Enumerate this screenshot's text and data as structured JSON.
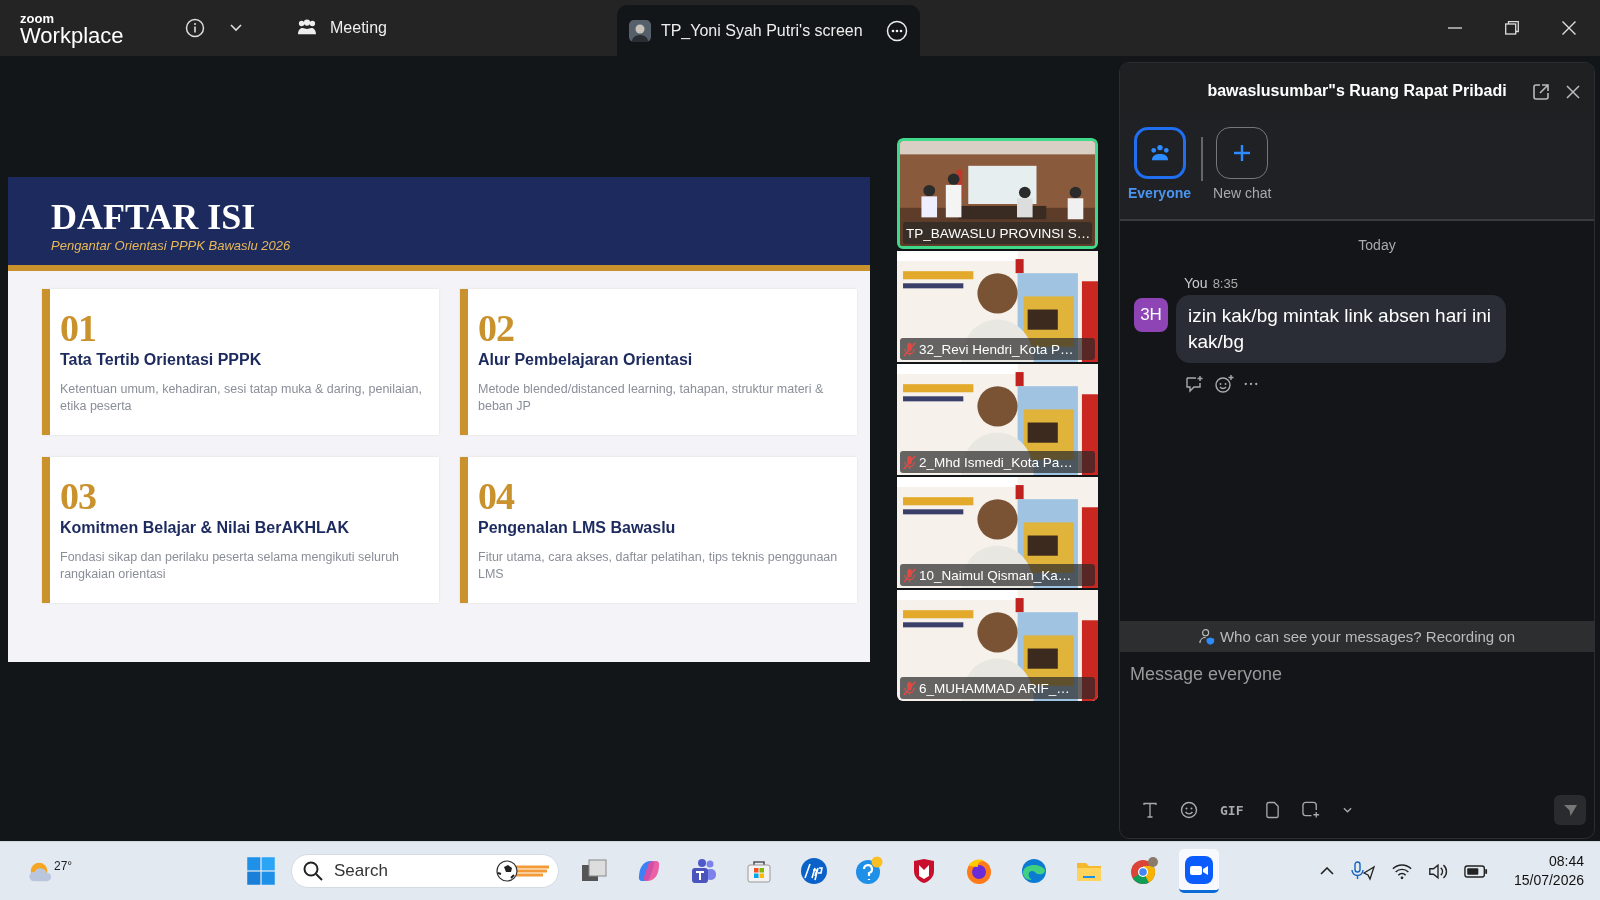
{
  "top_bar": {
    "logo_top": "zoom",
    "logo_bottom": "Workplace",
    "meeting_label": "Meeting",
    "share_tab": "TP_Yoni Syah Putri's screen"
  },
  "slide": {
    "title": "DAFTAR ISI",
    "subtitle": "Pengantar Orientasi PPPK Bawaslu 2026",
    "items": [
      {
        "number": "01",
        "title": "Tata Tertib Orientasi PPPK",
        "description": "Ketentuan umum, kehadiran, sesi tatap muka & daring, penilaian, etika peserta"
      },
      {
        "number": "02",
        "title": "Alur Pembelajaran Orientasi",
        "description": "Metode blended/distanced learning, tahapan, struktur materi & beban JP"
      },
      {
        "number": "03",
        "title": "Komitmen Belajar & Nilai BerAKHLAK",
        "description": "Fondasi sikap dan perilaku peserta selama mengikuti seluruh rangkaian orientasi"
      },
      {
        "number": "04",
        "title": "Pengenalan LMS Bawaslu",
        "description": "Fitur utama, cara akses, daftar pelatihan, tips teknis penggunaan LMS"
      }
    ]
  },
  "participants": [
    {
      "kind": "room",
      "name": "TP_BAWASLU PROVINSI S…",
      "muted": false,
      "speaking": true
    },
    {
      "kind": "person",
      "name": "32_Revi Hendri_Kota P…",
      "muted": true,
      "speaking": false
    },
    {
      "kind": "person",
      "name": "2_Mhd Ismedi_Kota Pa…",
      "muted": true,
      "speaking": false
    },
    {
      "kind": "person",
      "name": "10_Naimul Qisman_Ka…",
      "muted": true,
      "speaking": false
    },
    {
      "kind": "person",
      "name": "6_MUHAMMAD ARIF_…",
      "muted": true,
      "speaking": false
    }
  ],
  "chat": {
    "title": "bawaslusumbar\"s Ruang Rapat Pribadi",
    "tabs": [
      {
        "kind": "group",
        "label": "Everyone",
        "selected": true
      },
      {
        "kind": "new",
        "label": "New chat",
        "selected": false
      }
    ],
    "date": "Today",
    "messages": [
      {
        "avatar": "3H",
        "color": "#8e44b5",
        "sender": "You",
        "time": "8:35",
        "text": "izin kak/bg mintak link absen hari ini kak/bg"
      }
    ],
    "notice": "Who can see your messages? Recording on",
    "placeholder": "Message everyone",
    "gif_label": "GIF"
  },
  "taskbar": {
    "temperature": "27°",
    "search_placeholder": "Search",
    "time": "08:44",
    "date": "15/07/2026",
    "apps": [
      {
        "kind": "task-view",
        "selected": false
      },
      {
        "kind": "copilot",
        "selected": false
      },
      {
        "kind": "teams",
        "selected": false
      },
      {
        "kind": "store",
        "selected": false
      },
      {
        "kind": "hp",
        "selected": false
      },
      {
        "kind": "help",
        "selected": false
      },
      {
        "kind": "shield",
        "selected": false
      },
      {
        "kind": "firefox",
        "selected": false
      },
      {
        "kind": "edge",
        "selected": false
      },
      {
        "kind": "files",
        "selected": false
      },
      {
        "kind": "chrome",
        "selected": false
      },
      {
        "kind": "zoom",
        "selected": true
      }
    ]
  }
}
